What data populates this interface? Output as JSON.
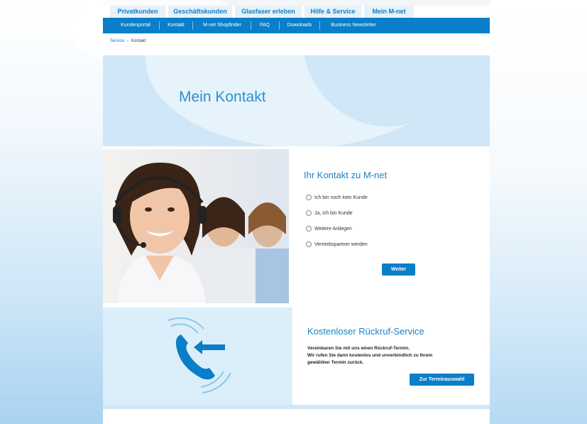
{
  "tabs": [
    {
      "label": "Privatkunden"
    },
    {
      "label": "Geschäftskunden"
    },
    {
      "label": "Glasfaser erleben"
    },
    {
      "label": "Hilfe & Service"
    },
    {
      "label": "Mein M-net"
    }
  ],
  "subnav": [
    {
      "label": "Kundenportal"
    },
    {
      "label": "Kontakt"
    },
    {
      "label": "M-net Shopfinder"
    },
    {
      "label": "FAQ"
    },
    {
      "label": "Downloads"
    },
    {
      "label": "Business Newsletter"
    }
  ],
  "breadcrumb": {
    "link": "Service",
    "separator": "›",
    "current": "Kontakt"
  },
  "hero": {
    "title": "Mein Kontakt"
  },
  "contact": {
    "title": "Ihr Kontakt zu M-net",
    "options": [
      {
        "label": "Ich bin noch kein Kunde"
      },
      {
        "label": "Ja, ich bin Kunde"
      },
      {
        "label": "Weitere Anliegen"
      },
      {
        "label": "Vertriebspartner werden"
      }
    ],
    "submit_label": "Weiter"
  },
  "callback": {
    "title": "Kostenloser Rückruf-Service",
    "line1": "Vereinbaren Sie mit uns einen Rückruf-Termin.",
    "line2": "Wir rufen Sie dann kostenlos und unverbindlich zu Ihrem",
    "line3": "gewählten Termin zurück.",
    "button_label": "Zur Terminauswahl"
  },
  "colors": {
    "brand_blue": "#0a7ec8",
    "light_blue": "#cfe7f6",
    "title_blue": "#1a82c9"
  }
}
